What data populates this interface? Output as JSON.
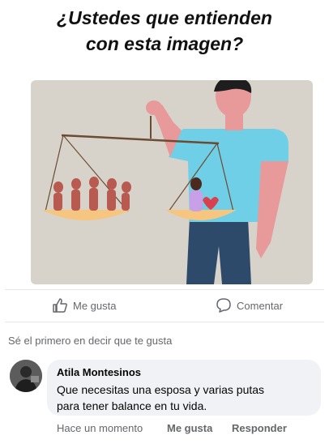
{
  "post": {
    "title_line1": "¿Ustedes que entienden",
    "title_line2": "con esta imagen?"
  },
  "illustration": {
    "background": "#d8d3ca",
    "shirt_color": "#6fcfe6",
    "pants_color": "#2e4a6b",
    "skin_color": "#e89a9a",
    "pan_color": "#f6c57f"
  },
  "actions": {
    "like_label": "Me gusta",
    "comment_label": "Comentar",
    "like_icon": "thumbs-up-icon",
    "comment_icon": "speech-bubble-icon"
  },
  "likes_summary": "Sé el primero en decir que te gusta",
  "comment": {
    "author": "Atila Montesinos",
    "text_line1": "Que necesitas una esposa y varias putas",
    "text_line2": "para tener balance en tu vida.",
    "time": "Hace un momento",
    "like_label": "Me gusta",
    "reply_label": "Responder"
  }
}
